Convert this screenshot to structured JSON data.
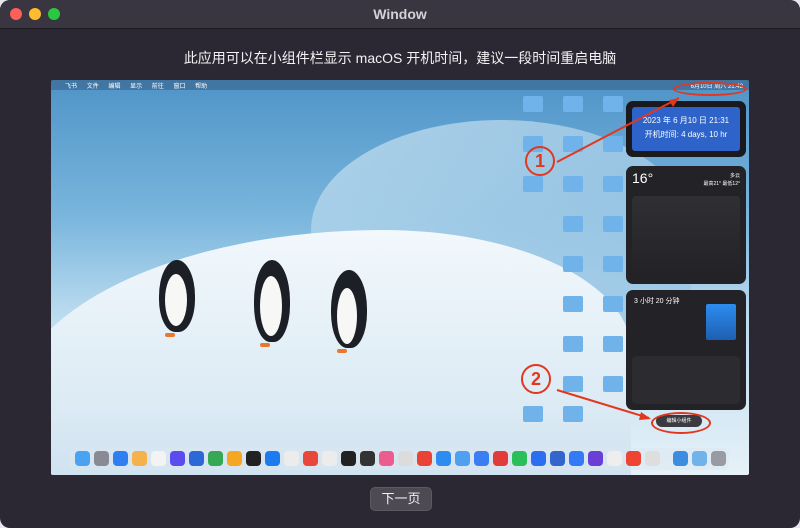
{
  "window": {
    "title": "Window"
  },
  "instruction": "此应用可以在小组件栏显示 macOS 开机时间，建议一段时间重启电脑",
  "screenshot": {
    "menubar": {
      "left_items": [
        "飞书",
        "文件",
        "编辑",
        "显示",
        "前往",
        "窗口",
        "帮助"
      ],
      "clock": "6月10日 周六 21:42"
    },
    "date_widget": {
      "line1": "2023 年 6 月10 日 21:31",
      "line2": "开机时间: 4 days, 10 hr"
    },
    "weather_widget": {
      "temp": "16°",
      "cond": "多云",
      "range": "最高21° 最低12°"
    },
    "screen_time_widget": {
      "title": "3 小时 20 分钟"
    },
    "edit_widgets_label": "编辑小组件",
    "marker_1": "1",
    "marker_2": "2"
  },
  "next_button": "下一页",
  "colors": {
    "annotation": "#e2371f",
    "accent": "#2e63c9"
  }
}
